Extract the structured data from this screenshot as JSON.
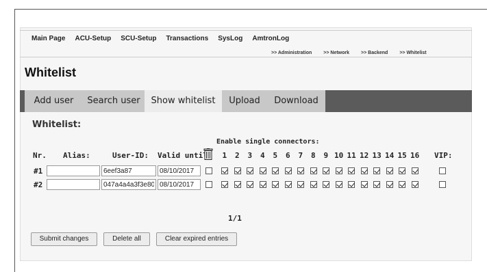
{
  "topnav": [
    "Main Page",
    "ACU-Setup",
    "SCU-Setup",
    "Transactions",
    "SysLog",
    "AmtronLog"
  ],
  "subnav": [
    ">> Administration",
    ">> Network",
    ">> Backend",
    ">> Whitelist"
  ],
  "page_title": "Whitelist",
  "tabs": [
    {
      "label": "Add user",
      "active": false
    },
    {
      "label": "Search user",
      "active": false
    },
    {
      "label": "Show whitelist",
      "active": true
    },
    {
      "label": "Upload",
      "active": false
    },
    {
      "label": "Download",
      "active": false
    }
  ],
  "section_title": "Whitelist:",
  "enable_label": "Enable single connectors:",
  "headers": {
    "nr": "Nr.",
    "alias": "Alias:",
    "userid": "User-ID:",
    "valid": "Valid until:",
    "vip": "VIP:"
  },
  "connectors": [
    "1",
    "2",
    "3",
    "4",
    "5",
    "6",
    "7",
    "8",
    "9",
    "10",
    "11",
    "12",
    "13",
    "14",
    "15",
    "16"
  ],
  "rows": [
    {
      "nr": "#1",
      "alias": "",
      "userid": "6eef3a87",
      "valid": "08/10/2017",
      "delete": false,
      "connectors": [
        true,
        true,
        true,
        true,
        true,
        true,
        true,
        true,
        true,
        true,
        true,
        true,
        true,
        true,
        true,
        true
      ],
      "vip": false
    },
    {
      "nr": "#2",
      "alias": "",
      "userid": "047a4a4a3f3e80",
      "valid": "08/10/2017",
      "delete": false,
      "connectors": [
        true,
        true,
        true,
        true,
        true,
        true,
        true,
        true,
        true,
        true,
        true,
        true,
        true,
        true,
        true,
        true
      ],
      "vip": false
    }
  ],
  "pager": "1/1",
  "buttons": {
    "submit": "Submit changes",
    "delete_all": "Delete all",
    "clear_expired": "Clear expired entries"
  },
  "icons": {
    "trash": "trash-icon"
  }
}
